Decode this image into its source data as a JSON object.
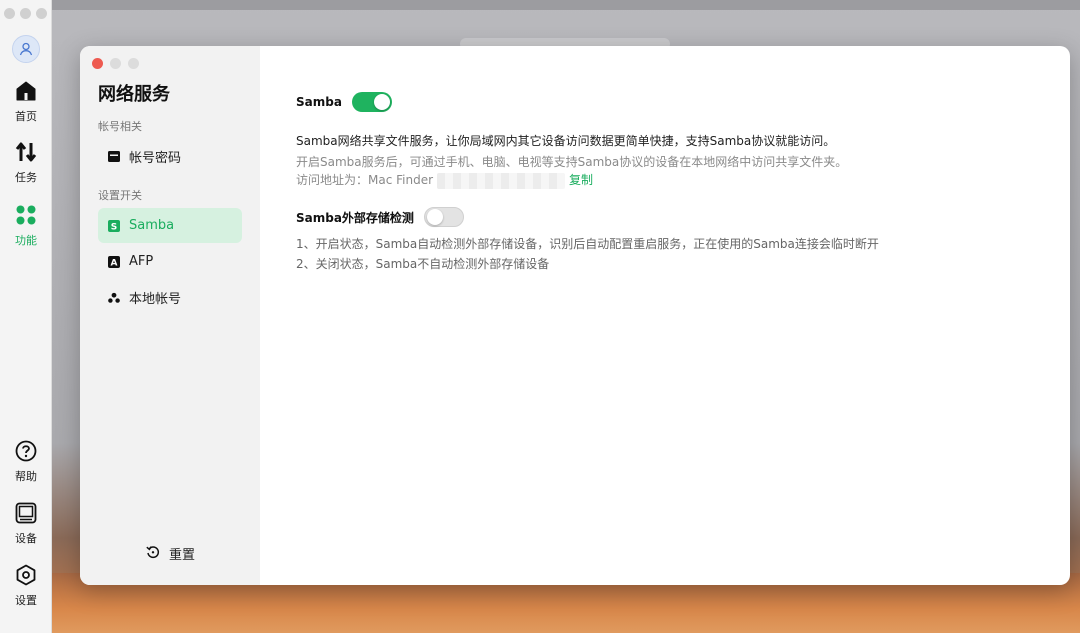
{
  "rail": {
    "items": [
      {
        "label": "首页",
        "icon": "home-icon"
      },
      {
        "label": "任务",
        "icon": "transfer-icon"
      },
      {
        "label": "功能",
        "icon": "grid-icon",
        "active": true
      },
      {
        "label": "帮助",
        "icon": "help-icon"
      },
      {
        "label": "设备",
        "icon": "device-icon"
      },
      {
        "label": "设置",
        "icon": "settings-icon"
      }
    ]
  },
  "sidebar": {
    "title": "网络服务",
    "section_account": "帐号相关",
    "section_switch": "设置开关",
    "items": [
      {
        "label": "帐号密码",
        "icon": "card-icon"
      },
      {
        "label": "Samba",
        "icon": "samba-icon",
        "active": true
      },
      {
        "label": "AFP",
        "icon": "afp-icon"
      },
      {
        "label": "本地帐号",
        "icon": "users-icon"
      }
    ],
    "reset_label": "重置"
  },
  "content": {
    "samba_label": "Samba",
    "samba_enabled": true,
    "samba_desc": "Samba网络共享文件服务，让你局域网内其它设备访问数据更简单快捷，支持Samba协议就能访问。",
    "samba_hint": "开启Samba服务后，可通过手机、电脑、电视等支持Samba协议的设备在本地网络中访问共享文件夹。",
    "address_prefix": "访问地址为：Mac Finder",
    "copy_label": "复制",
    "ext_label": "Samba外部存储检测",
    "ext_enabled": false,
    "ext_note_1": "1、开启状态，Samba自动检测外部存储设备，识别后自动配置重启服务，正在使用的Samba连接会临时断开",
    "ext_note_2": "2、关闭状态，Samba不自动检测外部存储设备"
  },
  "colors": {
    "accent": "#1aad5e",
    "toggle_on": "#1fb35f",
    "active_bg": "#d6f1e0"
  }
}
